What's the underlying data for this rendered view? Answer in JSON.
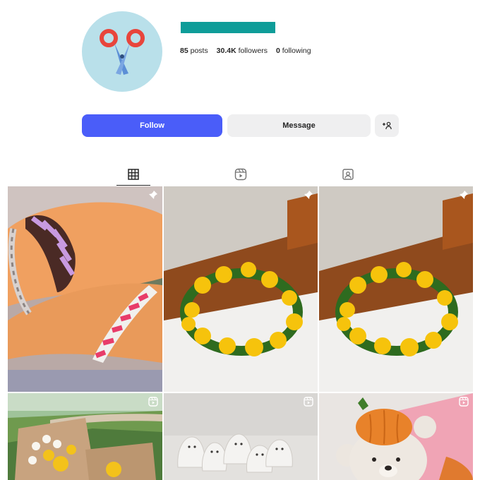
{
  "profile": {
    "stats": {
      "posts_count": "85",
      "posts_label": "posts",
      "followers_count": "30.4K",
      "followers_label": "followers",
      "following_count": "0",
      "following_label": "following"
    }
  },
  "actions": {
    "follow_label": "Follow",
    "message_label": "Message"
  },
  "tabs": [
    {
      "icon": "grid-icon",
      "active": true
    },
    {
      "icon": "reels-icon",
      "active": false
    },
    {
      "icon": "tagged-icon",
      "active": false
    }
  ],
  "posts": [
    {
      "subject": "bracelets",
      "badge": "pin-icon"
    },
    {
      "subject": "dandelion-crown",
      "badge": "pin-icon"
    },
    {
      "subject": "dandelion-crown",
      "badge": "pin-icon"
    },
    {
      "subject": "flower-bouquet",
      "badge": "reel-icon"
    },
    {
      "subject": "clay-ghosts",
      "badge": "reel-icon"
    },
    {
      "subject": "pumpkin-bear",
      "badge": "reel-icon"
    }
  ],
  "colors": {
    "follow_bg": "#4a5df9",
    "secondary_bg": "#efeff0",
    "name_bar": "#0f9d99",
    "avatar_bg": "#b9e0ea"
  }
}
